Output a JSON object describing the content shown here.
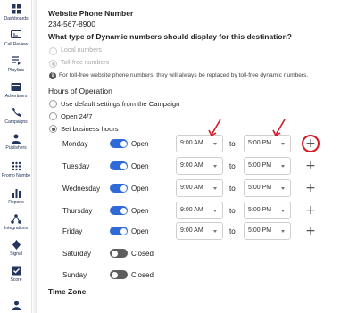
{
  "sidebar": {
    "items": [
      {
        "label": "Dashboards",
        "icon": "dashboard-icon"
      },
      {
        "label": "Call Review",
        "icon": "call-review-icon"
      },
      {
        "label": "Playlists",
        "icon": "playlists-icon"
      },
      {
        "label": "Advertisers",
        "icon": "advertisers-icon"
      },
      {
        "label": "Campaigns",
        "icon": "campaigns-icon"
      },
      {
        "label": "Publishers",
        "icon": "publishers-icon"
      },
      {
        "label": "Promo Numbe",
        "icon": "promo-numbers-icon"
      },
      {
        "label": "Reports",
        "icon": "reports-icon"
      },
      {
        "label": "Integrations",
        "icon": "integrations-icon"
      },
      {
        "label": "Signal",
        "icon": "signal-icon"
      },
      {
        "label": "Score",
        "icon": "score-icon"
      }
    ]
  },
  "website_phone": {
    "label": "Website Phone Number",
    "value": "234-567-8900"
  },
  "dynamic_numbers": {
    "question": "What type of Dynamic numbers should display for this destination?",
    "options": [
      {
        "label": "Local numbers",
        "selected": false
      },
      {
        "label": "Toll-free numbers",
        "selected": true
      }
    ],
    "info": "For toll-free website phone numbers, they will always be replaced by toll-free dynamic numbers."
  },
  "hours": {
    "title": "Hours of Operation",
    "options": [
      {
        "label": "Use default settings from the Campaign",
        "selected": false
      },
      {
        "label": "Open 24/7",
        "selected": false
      },
      {
        "label": "Set business hours",
        "selected": true
      }
    ],
    "to_label": "to",
    "days": [
      {
        "day": "Monday",
        "status": "Open",
        "open": true,
        "from": "9:00 AM",
        "to": "5:00 PM"
      },
      {
        "day": "Tuesday",
        "status": "Open",
        "open": true,
        "from": "9:00 AM",
        "to": "5:00 PM"
      },
      {
        "day": "Wednesday",
        "status": "Open",
        "open": true,
        "from": "9:00 AM",
        "to": "5:00 PM"
      },
      {
        "day": "Thursday",
        "status": "Open",
        "open": true,
        "from": "9:00 AM",
        "to": "5:00 PM"
      },
      {
        "day": "Friday",
        "status": "Open",
        "open": true,
        "from": "9:00 AM",
        "to": "5:00 PM"
      },
      {
        "day": "Saturday",
        "status": "Closed",
        "open": false
      },
      {
        "day": "Sunday",
        "status": "Closed",
        "open": false
      }
    ]
  },
  "time_zone": {
    "title": "Time Zone"
  },
  "colors": {
    "accent": "#2f6ad9",
    "annotation": "#d41a24",
    "nav_text": "#24365c"
  }
}
